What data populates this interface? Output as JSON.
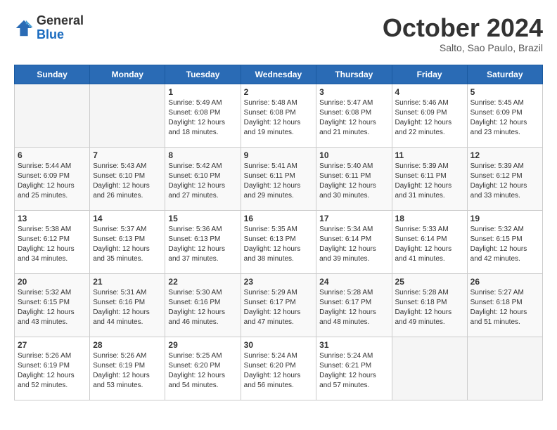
{
  "logo": {
    "general": "General",
    "blue": "Blue"
  },
  "header": {
    "month": "October 2024",
    "location": "Salto, Sao Paulo, Brazil"
  },
  "days_of_week": [
    "Sunday",
    "Monday",
    "Tuesday",
    "Wednesday",
    "Thursday",
    "Friday",
    "Saturday"
  ],
  "weeks": [
    [
      {
        "day": null,
        "info": null
      },
      {
        "day": null,
        "info": null
      },
      {
        "day": "1",
        "sunrise": "5:49 AM",
        "sunset": "6:08 PM",
        "daylight": "12 hours and 18 minutes."
      },
      {
        "day": "2",
        "sunrise": "5:48 AM",
        "sunset": "6:08 PM",
        "daylight": "12 hours and 19 minutes."
      },
      {
        "day": "3",
        "sunrise": "5:47 AM",
        "sunset": "6:08 PM",
        "daylight": "12 hours and 21 minutes."
      },
      {
        "day": "4",
        "sunrise": "5:46 AM",
        "sunset": "6:09 PM",
        "daylight": "12 hours and 22 minutes."
      },
      {
        "day": "5",
        "sunrise": "5:45 AM",
        "sunset": "6:09 PM",
        "daylight": "12 hours and 23 minutes."
      }
    ],
    [
      {
        "day": "6",
        "sunrise": "5:44 AM",
        "sunset": "6:09 PM",
        "daylight": "12 hours and 25 minutes."
      },
      {
        "day": "7",
        "sunrise": "5:43 AM",
        "sunset": "6:10 PM",
        "daylight": "12 hours and 26 minutes."
      },
      {
        "day": "8",
        "sunrise": "5:42 AM",
        "sunset": "6:10 PM",
        "daylight": "12 hours and 27 minutes."
      },
      {
        "day": "9",
        "sunrise": "5:41 AM",
        "sunset": "6:11 PM",
        "daylight": "12 hours and 29 minutes."
      },
      {
        "day": "10",
        "sunrise": "5:40 AM",
        "sunset": "6:11 PM",
        "daylight": "12 hours and 30 minutes."
      },
      {
        "day": "11",
        "sunrise": "5:39 AM",
        "sunset": "6:11 PM",
        "daylight": "12 hours and 31 minutes."
      },
      {
        "day": "12",
        "sunrise": "5:39 AM",
        "sunset": "6:12 PM",
        "daylight": "12 hours and 33 minutes."
      }
    ],
    [
      {
        "day": "13",
        "sunrise": "5:38 AM",
        "sunset": "6:12 PM",
        "daylight": "12 hours and 34 minutes."
      },
      {
        "day": "14",
        "sunrise": "5:37 AM",
        "sunset": "6:13 PM",
        "daylight": "12 hours and 35 minutes."
      },
      {
        "day": "15",
        "sunrise": "5:36 AM",
        "sunset": "6:13 PM",
        "daylight": "12 hours and 37 minutes."
      },
      {
        "day": "16",
        "sunrise": "5:35 AM",
        "sunset": "6:13 PM",
        "daylight": "12 hours and 38 minutes."
      },
      {
        "day": "17",
        "sunrise": "5:34 AM",
        "sunset": "6:14 PM",
        "daylight": "12 hours and 39 minutes."
      },
      {
        "day": "18",
        "sunrise": "5:33 AM",
        "sunset": "6:14 PM",
        "daylight": "12 hours and 41 minutes."
      },
      {
        "day": "19",
        "sunrise": "5:32 AM",
        "sunset": "6:15 PM",
        "daylight": "12 hours and 42 minutes."
      }
    ],
    [
      {
        "day": "20",
        "sunrise": "5:32 AM",
        "sunset": "6:15 PM",
        "daylight": "12 hours and 43 minutes."
      },
      {
        "day": "21",
        "sunrise": "5:31 AM",
        "sunset": "6:16 PM",
        "daylight": "12 hours and 44 minutes."
      },
      {
        "day": "22",
        "sunrise": "5:30 AM",
        "sunset": "6:16 PM",
        "daylight": "12 hours and 46 minutes."
      },
      {
        "day": "23",
        "sunrise": "5:29 AM",
        "sunset": "6:17 PM",
        "daylight": "12 hours and 47 minutes."
      },
      {
        "day": "24",
        "sunrise": "5:28 AM",
        "sunset": "6:17 PM",
        "daylight": "12 hours and 48 minutes."
      },
      {
        "day": "25",
        "sunrise": "5:28 AM",
        "sunset": "6:18 PM",
        "daylight": "12 hours and 49 minutes."
      },
      {
        "day": "26",
        "sunrise": "5:27 AM",
        "sunset": "6:18 PM",
        "daylight": "12 hours and 51 minutes."
      }
    ],
    [
      {
        "day": "27",
        "sunrise": "5:26 AM",
        "sunset": "6:19 PM",
        "daylight": "12 hours and 52 minutes."
      },
      {
        "day": "28",
        "sunrise": "5:26 AM",
        "sunset": "6:19 PM",
        "daylight": "12 hours and 53 minutes."
      },
      {
        "day": "29",
        "sunrise": "5:25 AM",
        "sunset": "6:20 PM",
        "daylight": "12 hours and 54 minutes."
      },
      {
        "day": "30",
        "sunrise": "5:24 AM",
        "sunset": "6:20 PM",
        "daylight": "12 hours and 56 minutes."
      },
      {
        "day": "31",
        "sunrise": "5:24 AM",
        "sunset": "6:21 PM",
        "daylight": "12 hours and 57 minutes."
      },
      {
        "day": null,
        "info": null
      },
      {
        "day": null,
        "info": null
      }
    ]
  ]
}
